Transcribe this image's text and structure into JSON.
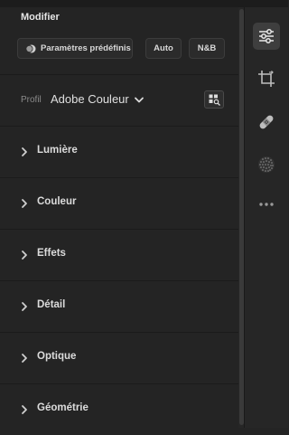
{
  "edit": {
    "title": "Modifier",
    "presets_label": "Paramètres prédéfinis",
    "auto_label": "Auto",
    "bw_label": "N&B"
  },
  "profile": {
    "label": "Profil",
    "value": "Adobe Couleur"
  },
  "sections": [
    {
      "label": "Lumière"
    },
    {
      "label": "Couleur"
    },
    {
      "label": "Effets"
    },
    {
      "label": "Détail"
    },
    {
      "label": "Optique"
    },
    {
      "label": "Géométrie"
    }
  ],
  "rail": {
    "items": [
      {
        "icon": "sliders-icon",
        "active": true
      },
      {
        "icon": "crop-icon",
        "active": false
      },
      {
        "icon": "healing-bandage-icon",
        "active": false
      },
      {
        "icon": "masking-icon",
        "active": false
      },
      {
        "icon": "more-icon",
        "active": false
      }
    ]
  },
  "colors": {
    "background": "#242424",
    "rail": "#262626",
    "text": "#dcdcdc"
  }
}
